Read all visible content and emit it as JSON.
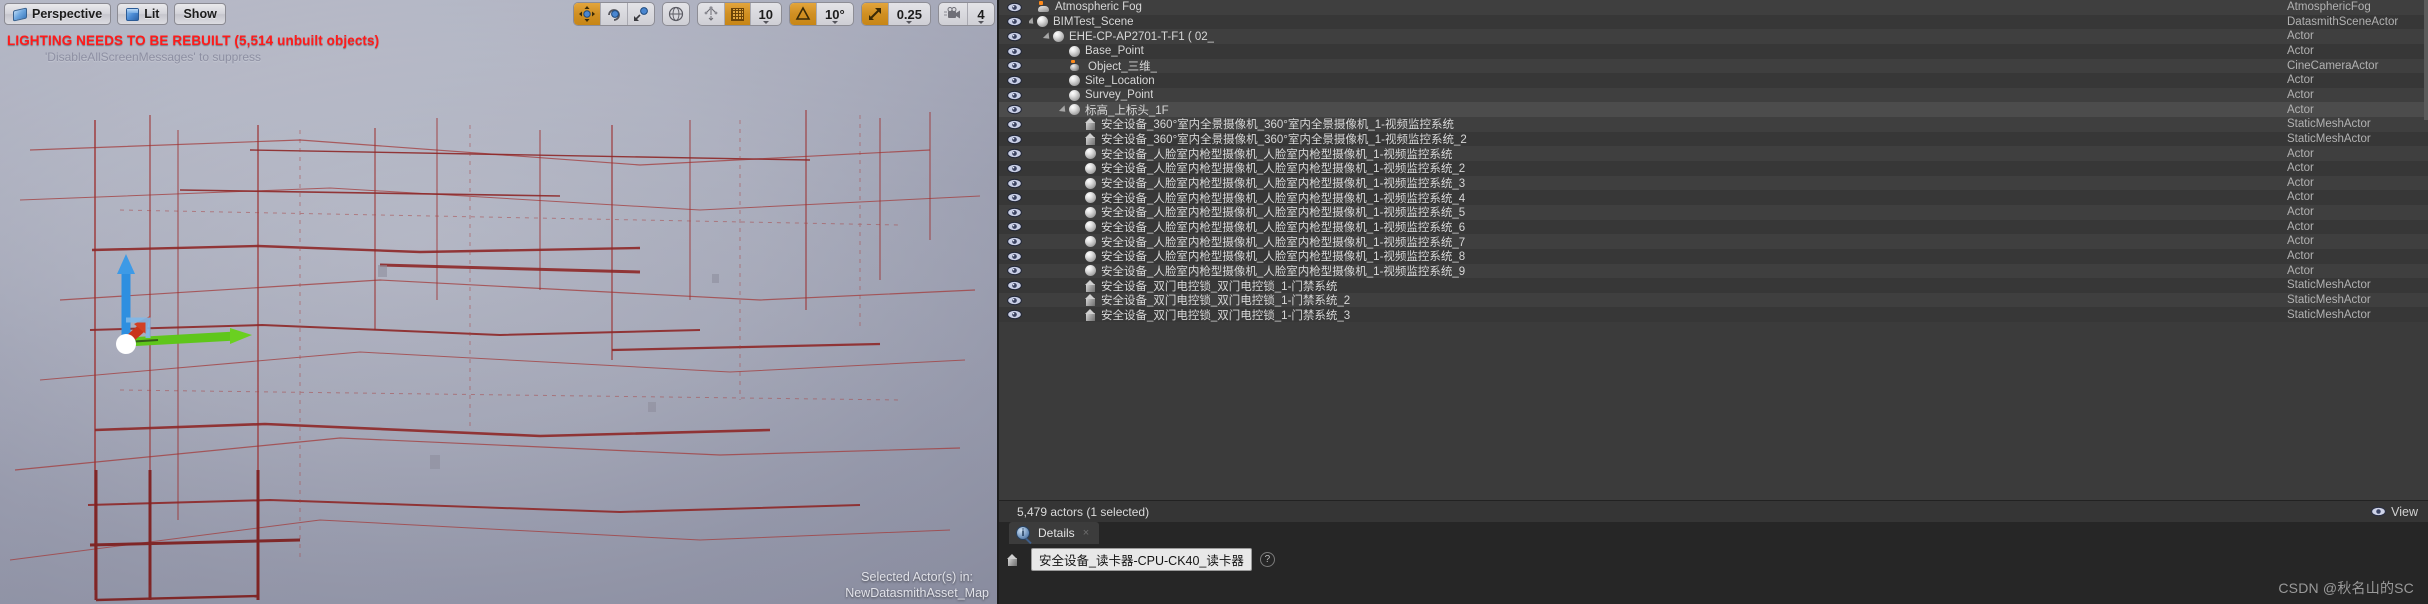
{
  "viewport": {
    "buttons": [
      {
        "label": "Perspective",
        "icon": "perspective-icon"
      },
      {
        "label": "Lit",
        "icon": "lit-cube-icon"
      },
      {
        "label": "Show",
        "icon": "none"
      }
    ],
    "warning": "LIGHTING NEEDS TO BE REBUILT (5,514 unbuilt objects)",
    "warning_color": "#ff1a1a",
    "sub_message": "'DisableAllScreenMessages' to suppress",
    "selected_actor_line1": "Selected Actor(s) in:",
    "selected_actor_line2": "NewDatasmithAsset_Map",
    "gizmo": {
      "x_axis_color": "#c9351a",
      "y_axis_color": "#5fc61b",
      "z_axis_color": "#2e8fe0"
    }
  },
  "toolbar": {
    "groups": [
      {
        "name": "transform-modes",
        "items": [
          {
            "icon": "move-icon",
            "active": true
          },
          {
            "icon": "rotate-icon",
            "active": false
          },
          {
            "icon": "scale-icon",
            "active": false
          }
        ]
      },
      {
        "name": "coordinate-system",
        "items": [
          {
            "icon": "globe-icon",
            "active": false
          }
        ]
      },
      {
        "name": "surface-snap-grid",
        "items": [
          {
            "icon": "surface-snap-icon",
            "active": false
          },
          {
            "icon": "grid-snap-icon",
            "active": true
          },
          {
            "value": "10",
            "dropdown": true
          }
        ]
      },
      {
        "name": "rotation-snap",
        "items": [
          {
            "icon": "angle-snap-icon",
            "active": true
          },
          {
            "value": "10°",
            "dropdown": true
          }
        ]
      },
      {
        "name": "scale-snap",
        "items": [
          {
            "icon": "scale-snap-icon",
            "active": true
          },
          {
            "value": "0.25",
            "dropdown": true
          }
        ]
      },
      {
        "name": "camera-speed",
        "items": [
          {
            "icon": "camera-speed-icon",
            "active": false
          },
          {
            "value": "4",
            "dropdown": true
          }
        ]
      }
    ]
  },
  "outliner": {
    "type_column_header": "",
    "rows": [
      {
        "label": "Atmospheric Fog",
        "type": "AtmosphericFog",
        "indent": 0,
        "icon": "fog-icon",
        "expander": "none",
        "selected": false
      },
      {
        "label": "BIMTest_Scene",
        "type": "DatasmithSceneActor",
        "indent": 0,
        "icon": "sphere-icon",
        "expander": "expanded",
        "selected": false
      },
      {
        "label": "EHE-CP-AP2701-T-F1 ( 02_",
        "type": "Actor",
        "indent": 1,
        "icon": "sphere-icon",
        "expander": "expanded",
        "selected": false
      },
      {
        "label": "Base_Point",
        "type": "Actor",
        "indent": 2,
        "icon": "sphere-icon",
        "expander": "none",
        "selected": false
      },
      {
        "label": "Object_三维_",
        "type": "CineCameraActor",
        "indent": 2,
        "icon": "cine-camera-icon",
        "expander": "none",
        "selected": false
      },
      {
        "label": "Site_Location",
        "type": "Actor",
        "indent": 2,
        "icon": "sphere-icon",
        "expander": "none",
        "selected": false
      },
      {
        "label": "Survey_Point",
        "type": "Actor",
        "indent": 2,
        "icon": "sphere-icon",
        "expander": "none",
        "selected": false
      },
      {
        "label": "标高_上标头_1F",
        "type": "Actor",
        "indent": 2,
        "icon": "sphere-icon",
        "expander": "expanded",
        "selected": true
      },
      {
        "label": "安全设备_360°室内全景摄像机_360°室内全景摄像机_1-视频监控系统",
        "type": "StaticMeshActor",
        "indent": 3,
        "icon": "mesh-icon",
        "expander": "none",
        "selected": false
      },
      {
        "label": "安全设备_360°室内全景摄像机_360°室内全景摄像机_1-视频监控系统_2",
        "type": "StaticMeshActor",
        "indent": 3,
        "icon": "mesh-icon",
        "expander": "none",
        "selected": false
      },
      {
        "label": "安全设备_人脸室内枪型摄像机_人脸室内枪型摄像机_1-视频监控系统",
        "type": "Actor",
        "indent": 3,
        "icon": "sphere-icon",
        "expander": "none",
        "selected": false
      },
      {
        "label": "安全设备_人脸室内枪型摄像机_人脸室内枪型摄像机_1-视频监控系统_2",
        "type": "Actor",
        "indent": 3,
        "icon": "sphere-icon",
        "expander": "none",
        "selected": false
      },
      {
        "label": "安全设备_人脸室内枪型摄像机_人脸室内枪型摄像机_1-视频监控系统_3",
        "type": "Actor",
        "indent": 3,
        "icon": "sphere-icon",
        "expander": "none",
        "selected": false
      },
      {
        "label": "安全设备_人脸室内枪型摄像机_人脸室内枪型摄像机_1-视频监控系统_4",
        "type": "Actor",
        "indent": 3,
        "icon": "sphere-icon",
        "expander": "none",
        "selected": false
      },
      {
        "label": "安全设备_人脸室内枪型摄像机_人脸室内枪型摄像机_1-视频监控系统_5",
        "type": "Actor",
        "indent": 3,
        "icon": "sphere-icon",
        "expander": "none",
        "selected": false
      },
      {
        "label": "安全设备_人脸室内枪型摄像机_人脸室内枪型摄像机_1-视频监控系统_6",
        "type": "Actor",
        "indent": 3,
        "icon": "sphere-icon",
        "expander": "none",
        "selected": false
      },
      {
        "label": "安全设备_人脸室内枪型摄像机_人脸室内枪型摄像机_1-视频监控系统_7",
        "type": "Actor",
        "indent": 3,
        "icon": "sphere-icon",
        "expander": "none",
        "selected": false
      },
      {
        "label": "安全设备_人脸室内枪型摄像机_人脸室内枪型摄像机_1-视频监控系统_8",
        "type": "Actor",
        "indent": 3,
        "icon": "sphere-icon",
        "expander": "none",
        "selected": false
      },
      {
        "label": "安全设备_人脸室内枪型摄像机_人脸室内枪型摄像机_1-视频监控系统_9",
        "type": "Actor",
        "indent": 3,
        "icon": "sphere-icon",
        "expander": "none",
        "selected": false
      },
      {
        "label": "安全设备_双门电控锁_双门电控锁_1-门禁系统",
        "type": "StaticMeshActor",
        "indent": 3,
        "icon": "mesh-icon",
        "expander": "none",
        "selected": false
      },
      {
        "label": "安全设备_双门电控锁_双门电控锁_1-门禁系统_2",
        "type": "StaticMeshActor",
        "indent": 3,
        "icon": "mesh-icon",
        "expander": "none",
        "selected": false
      },
      {
        "label": "安全设备_双门电控锁_双门电控锁_1-门禁系统_3",
        "type": "StaticMeshActor",
        "indent": 3,
        "icon": "mesh-icon",
        "expander": "none",
        "selected": false
      }
    ]
  },
  "status": {
    "actor_count_text": "5,479 actors (1 selected)",
    "view_button_label": "View"
  },
  "details": {
    "tab_label": "Details",
    "close_label": "×",
    "actor_name": "安全设备_读卡器-CPU-CK40_读卡器",
    "help_label": "?"
  },
  "watermark": "CSDN @秋名山的SC"
}
